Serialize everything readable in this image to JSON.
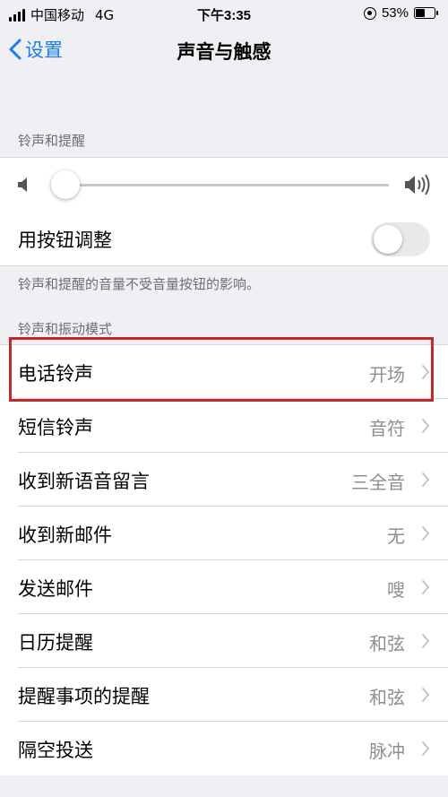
{
  "status_bar": {
    "carrier": "中国移动",
    "network": "4G",
    "time": "下午3:35",
    "battery_percent": "53%",
    "battery_level": 0.53
  },
  "nav": {
    "back_label": "设置",
    "title": "声音与触感"
  },
  "ringer_section": {
    "header": "铃声和提醒",
    "volume_level": 0.02,
    "change_with_buttons_label": "用按钮调整",
    "change_with_buttons_on": false,
    "footnote": "铃声和提醒的音量不受音量按钮的影响。"
  },
  "patterns_section": {
    "header": "铃声和振动模式",
    "items": [
      {
        "label": "电话铃声",
        "value": "开场"
      },
      {
        "label": "短信铃声",
        "value": "音符"
      },
      {
        "label": "收到新语音留言",
        "value": "三全音"
      },
      {
        "label": "收到新邮件",
        "value": "无"
      },
      {
        "label": "发送邮件",
        "value": "嗖"
      },
      {
        "label": "日历提醒",
        "value": "和弦"
      },
      {
        "label": "提醒事项的提醒",
        "value": "和弦"
      },
      {
        "label": "隔空投送",
        "value": "脉冲"
      }
    ]
  },
  "colors": {
    "accent": "#1a7cf5",
    "highlight": "#c62828",
    "background": "#efeff4"
  }
}
